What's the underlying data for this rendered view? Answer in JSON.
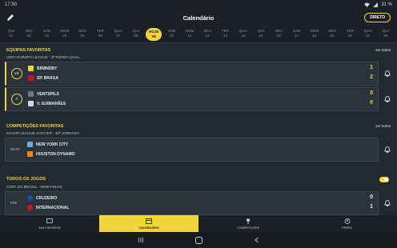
{
  "status": {
    "time": "17:50",
    "battery": "31 %"
  },
  "header": {
    "title": "Calendário",
    "live_label": "DIRETO"
  },
  "days": [
    {
      "wd": "QUI",
      "d": "01"
    },
    {
      "wd": "SEX",
      "d": "02"
    },
    {
      "wd": "SÁB",
      "d": "03"
    },
    {
      "wd": "DOM",
      "d": "04"
    },
    {
      "wd": "SEG",
      "d": "05"
    },
    {
      "wd": "TER",
      "d": "06"
    },
    {
      "wd": "QUA",
      "d": "07"
    },
    {
      "wd": "QUI",
      "d": "08"
    },
    {
      "wd": "HOJE",
      "d": "09"
    },
    {
      "wd": "SÁB",
      "d": "10"
    },
    {
      "wd": "DOM",
      "d": "11"
    },
    {
      "wd": "SEG",
      "d": "12"
    },
    {
      "wd": "TER",
      "d": "13"
    },
    {
      "wd": "QUA",
      "d": "14"
    },
    {
      "wd": "QUI",
      "d": "15"
    },
    {
      "wd": "SEX",
      "d": "16"
    },
    {
      "wd": "SÁB",
      "d": "17"
    },
    {
      "wd": "DOM",
      "d": "18"
    },
    {
      "wd": "SEG",
      "d": "19"
    },
    {
      "wd": "TER",
      "d": "20"
    },
    {
      "wd": "QUA",
      "d": "21"
    },
    {
      "wd": "QUI",
      "d": "22"
    }
  ],
  "favorites": {
    "title": "EQUIPAS FAVORITAS",
    "see_all": "ver todos",
    "competition": "UEFA EUROPA LEAGUE - 3ª RONDA QUAL.",
    "matches": [
      {
        "minute": "19'",
        "home": "BRØNDBY",
        "away": "SP. BRAGA",
        "home_score": "1",
        "away_score": "2"
      },
      {
        "minute": "4'",
        "home": "VENTSPILS",
        "away": "V. GUIMARÃES",
        "home_score": "0",
        "away_score": "0"
      }
    ]
  },
  "competitions": {
    "title": "COMPETIÇÕES FAVORITAS",
    "see_all": "ver todos",
    "competition": "MAJOR LEAGUE SOCCER - 30ª JORNADA",
    "match": {
      "time": "00:00",
      "home": "NEW YORK CITY",
      "away": "HOUSTON DYNAMO"
    }
  },
  "all_games": {
    "title": "TODOS OS JOGOS",
    "competition": "COPA DO BRASIL - SEMI-FINAIS",
    "match": {
      "status": "FIM",
      "home": "CRUZEIRO",
      "away": "INTERNACIONAL",
      "home_score": "0",
      "away_score": "1"
    }
  },
  "tabs": [
    "MULTISCREEN",
    "CALENDÁRIO",
    "COMPETIÇÕES",
    "PERFIL"
  ],
  "colors": {
    "accent": "#f2d53c",
    "background": "#222a31"
  }
}
